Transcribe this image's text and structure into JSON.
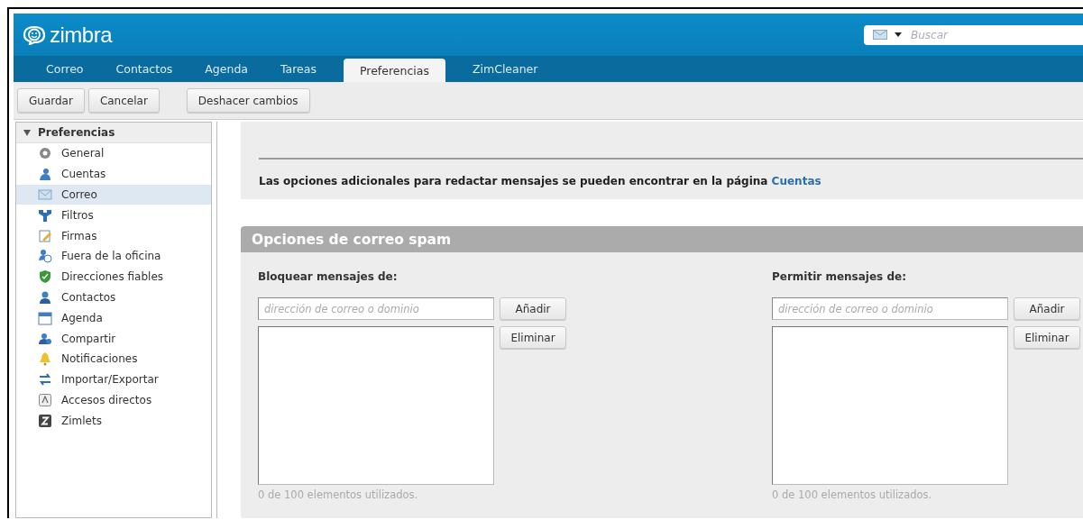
{
  "app": {
    "logo": "zimbra",
    "search": {
      "placeholder": "Buscar"
    }
  },
  "tabs": [
    {
      "label": "Correo",
      "selected": false
    },
    {
      "label": "Contactos",
      "selected": false
    },
    {
      "label": "Agenda",
      "selected": false
    },
    {
      "label": "Tareas",
      "selected": false
    },
    {
      "label": "Preferencias",
      "selected": true
    },
    {
      "label": "ZimCleaner",
      "selected": false
    }
  ],
  "toolbar": {
    "left_buttons": [
      "Guardar",
      "Cancelar"
    ],
    "right_buttons": [
      "Deshacer cambios"
    ]
  },
  "sidebar": {
    "title": "Preferencias",
    "expanded": true,
    "items": [
      {
        "label": "General",
        "selected": false
      },
      {
        "label": "Cuentas",
        "selected": false
      },
      {
        "label": "Correo",
        "selected": true
      },
      {
        "label": "Filtros",
        "selected": false
      },
      {
        "label": "Firmas",
        "selected": false
      },
      {
        "label": "Fuera de la oficina",
        "selected": false
      },
      {
        "label": "Direcciones fiables",
        "selected": false
      },
      {
        "label": "Contactos",
        "selected": false
      },
      {
        "label": "Agenda",
        "selected": false
      },
      {
        "label": "Compartir",
        "selected": false
      },
      {
        "label": "Notificaciones",
        "selected": false
      },
      {
        "label": "Importar/Exportar",
        "selected": false
      },
      {
        "label": "Accesos directos",
        "selected": false
      },
      {
        "label": "Zimlets",
        "selected": false
      }
    ]
  },
  "info": {
    "text": "Las opciones adicionales para redactar mensajes se pueden encontrar en la página",
    "link": "Cuentas"
  },
  "spam": {
    "title": "Opciones de correo spam",
    "columns": [
      {
        "heading": "Bloquear mensajes de:",
        "placeholder": "dirección de correo o dominio",
        "add_button": "Añadir",
        "remove_button": "Eliminar",
        "usage": "0 de 100 elementos utilizados."
      },
      {
        "heading": "Permitir mensajes de:",
        "placeholder": "dirección de correo o dominio",
        "add_button": "Añadir",
        "remove_button": "Eliminar",
        "usage": "0 de 100 elementos utilizados."
      }
    ]
  }
}
